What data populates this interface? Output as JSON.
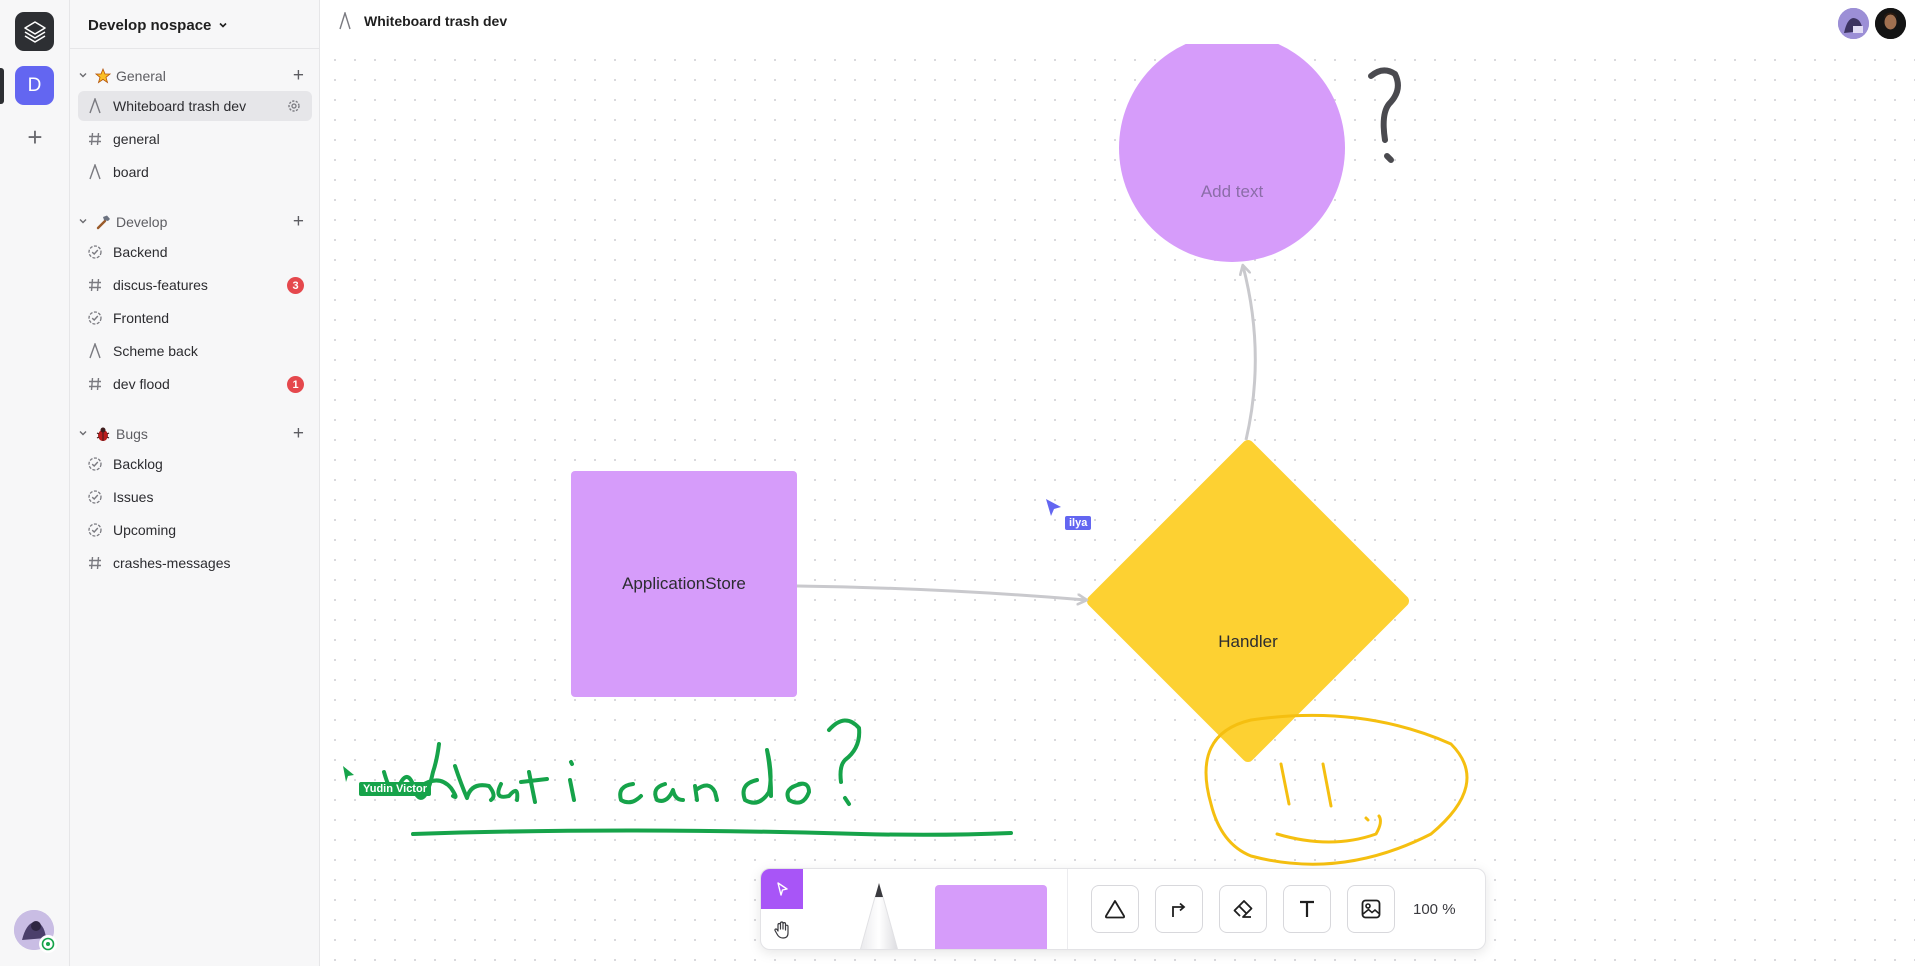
{
  "workspace": {
    "name": "Develop nospace",
    "space_initial": "D"
  },
  "page": {
    "title": "Whiteboard trash dev"
  },
  "colors": {
    "accent": "#a855f7",
    "space": "#6366f1",
    "shape_purple": "#d69cfa",
    "shape_yellow": "#fdd132",
    "ink_green": "#16a34a",
    "ink_yellow": "#f5bf10",
    "badge_red": "#e5484d",
    "cursor_ilya": "#6366f1",
    "cursor_yudin": "#16a34a"
  },
  "sidebar": {
    "sections": [
      {
        "name": "General",
        "emoji": "star-icon",
        "items": [
          {
            "label": "Whiteboard trash dev",
            "icon": "whiteboard-icon",
            "active": true
          },
          {
            "label": "general",
            "icon": "hash-icon"
          },
          {
            "label": "board",
            "icon": "whiteboard-icon"
          }
        ]
      },
      {
        "name": "Develop",
        "emoji": "hammer-icon",
        "items": [
          {
            "label": "Backend",
            "icon": "task-icon"
          },
          {
            "label": "discus-features",
            "icon": "hash-icon",
            "badge": "3"
          },
          {
            "label": "Frontend",
            "icon": "task-icon"
          },
          {
            "label": "Scheme back",
            "icon": "whiteboard-icon"
          },
          {
            "label": "dev flood",
            "icon": "hash-icon",
            "badge": "1"
          }
        ]
      },
      {
        "name": "Bugs",
        "emoji": "bug-icon",
        "items": [
          {
            "label": "Backlog",
            "icon": "task-icon"
          },
          {
            "label": "Issues",
            "icon": "task-icon"
          },
          {
            "label": "Upcoming",
            "icon": "task-icon"
          },
          {
            "label": "crashes-messages",
            "icon": "hash-icon"
          }
        ]
      }
    ]
  },
  "board": {
    "circle_placeholder": "Add text",
    "rect_label": "ApplicationStore",
    "diamond_label": "Handler",
    "question_mark": "?",
    "cursors": [
      {
        "name": "ilya"
      },
      {
        "name": "Yudin Victor"
      }
    ]
  },
  "toolbar": {
    "zoom": "100 %"
  }
}
